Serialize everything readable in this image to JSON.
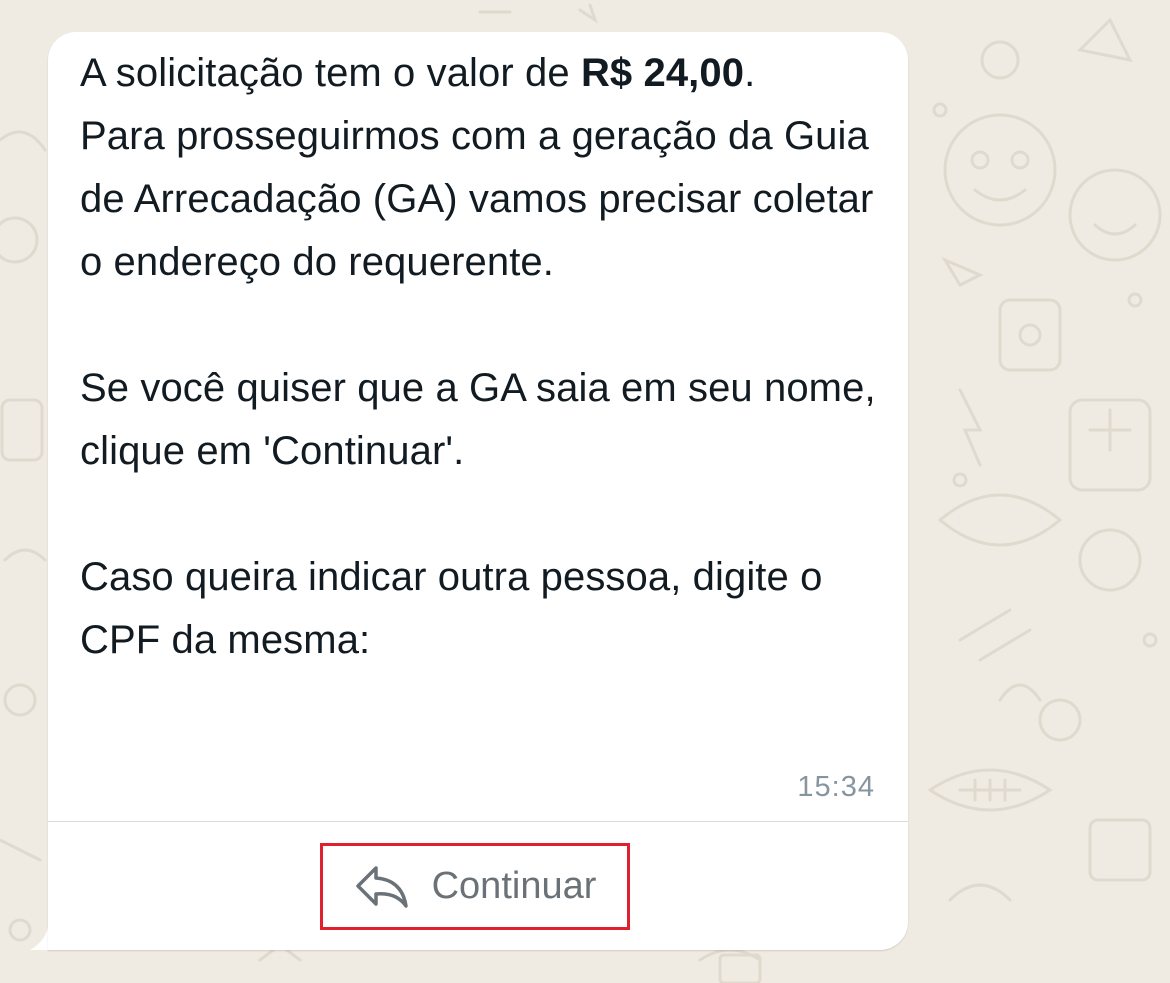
{
  "message": {
    "line1_prefix": "A solicitação tem o valor de ",
    "amount": "R$ 24,00",
    "line1_suffix": ".",
    "paragraph1": "Para prosseguirmos com a geração da Guia de Arrecadação (GA) vamos precisar coletar o endereço do requerente.",
    "paragraph2": "Se você quiser que a GA saia em seu nome, clique em 'Continuar'.",
    "paragraph3": "Caso queira indicar outra pessoa, digite o CPF da mesma:",
    "timestamp": "15:34"
  },
  "reply_button": {
    "label": "Continuar",
    "icon": "reply-arrow-icon",
    "highlight_color": "#e0202f"
  },
  "colors": {
    "background": "#efeae2",
    "bubble": "#ffffff",
    "text": "#111b21",
    "timestamp": "#8696a0"
  }
}
